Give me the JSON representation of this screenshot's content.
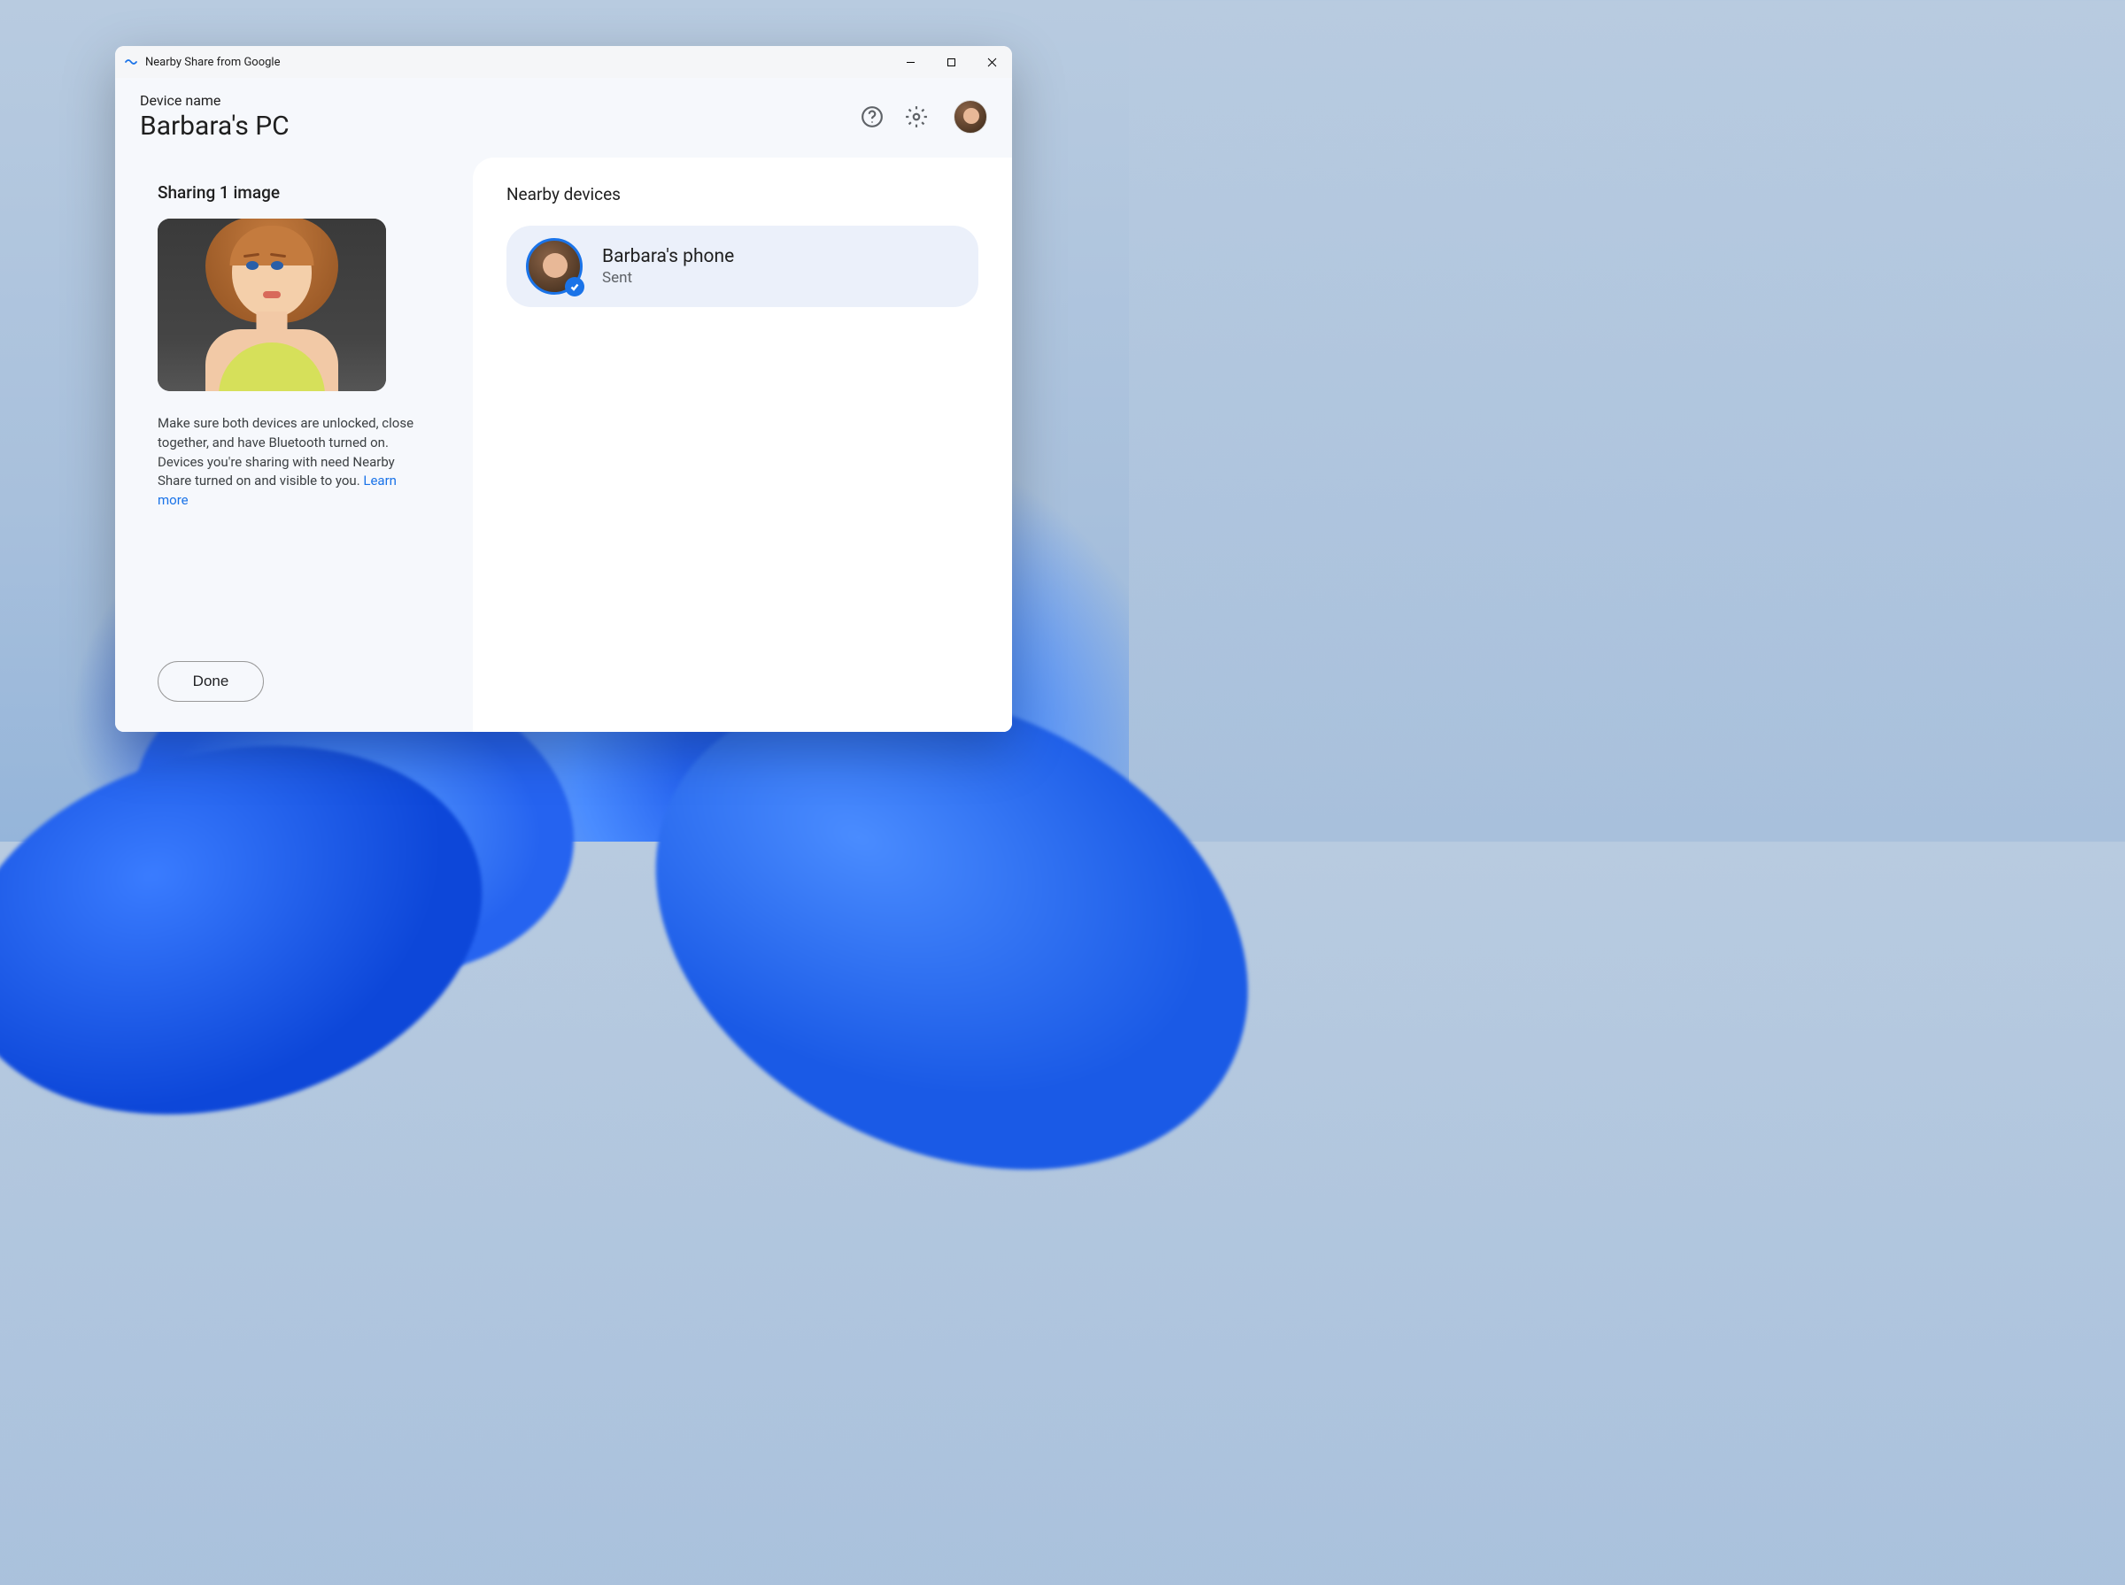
{
  "window": {
    "title": "Nearby Share from Google"
  },
  "header": {
    "device_label": "Device name",
    "device_name": "Barbara's PC"
  },
  "left": {
    "sharing_title": "Sharing 1 image",
    "help_text": "Make sure both devices are unlocked, close together, and have Bluetooth turned on. Devices you're sharing with need Nearby Share turned on and visible to you. ",
    "learn_more": "Learn more",
    "done_label": "Done"
  },
  "right": {
    "nearby_title": "Nearby devices",
    "devices": [
      {
        "name": "Barbara's phone",
        "status": "Sent"
      }
    ]
  }
}
